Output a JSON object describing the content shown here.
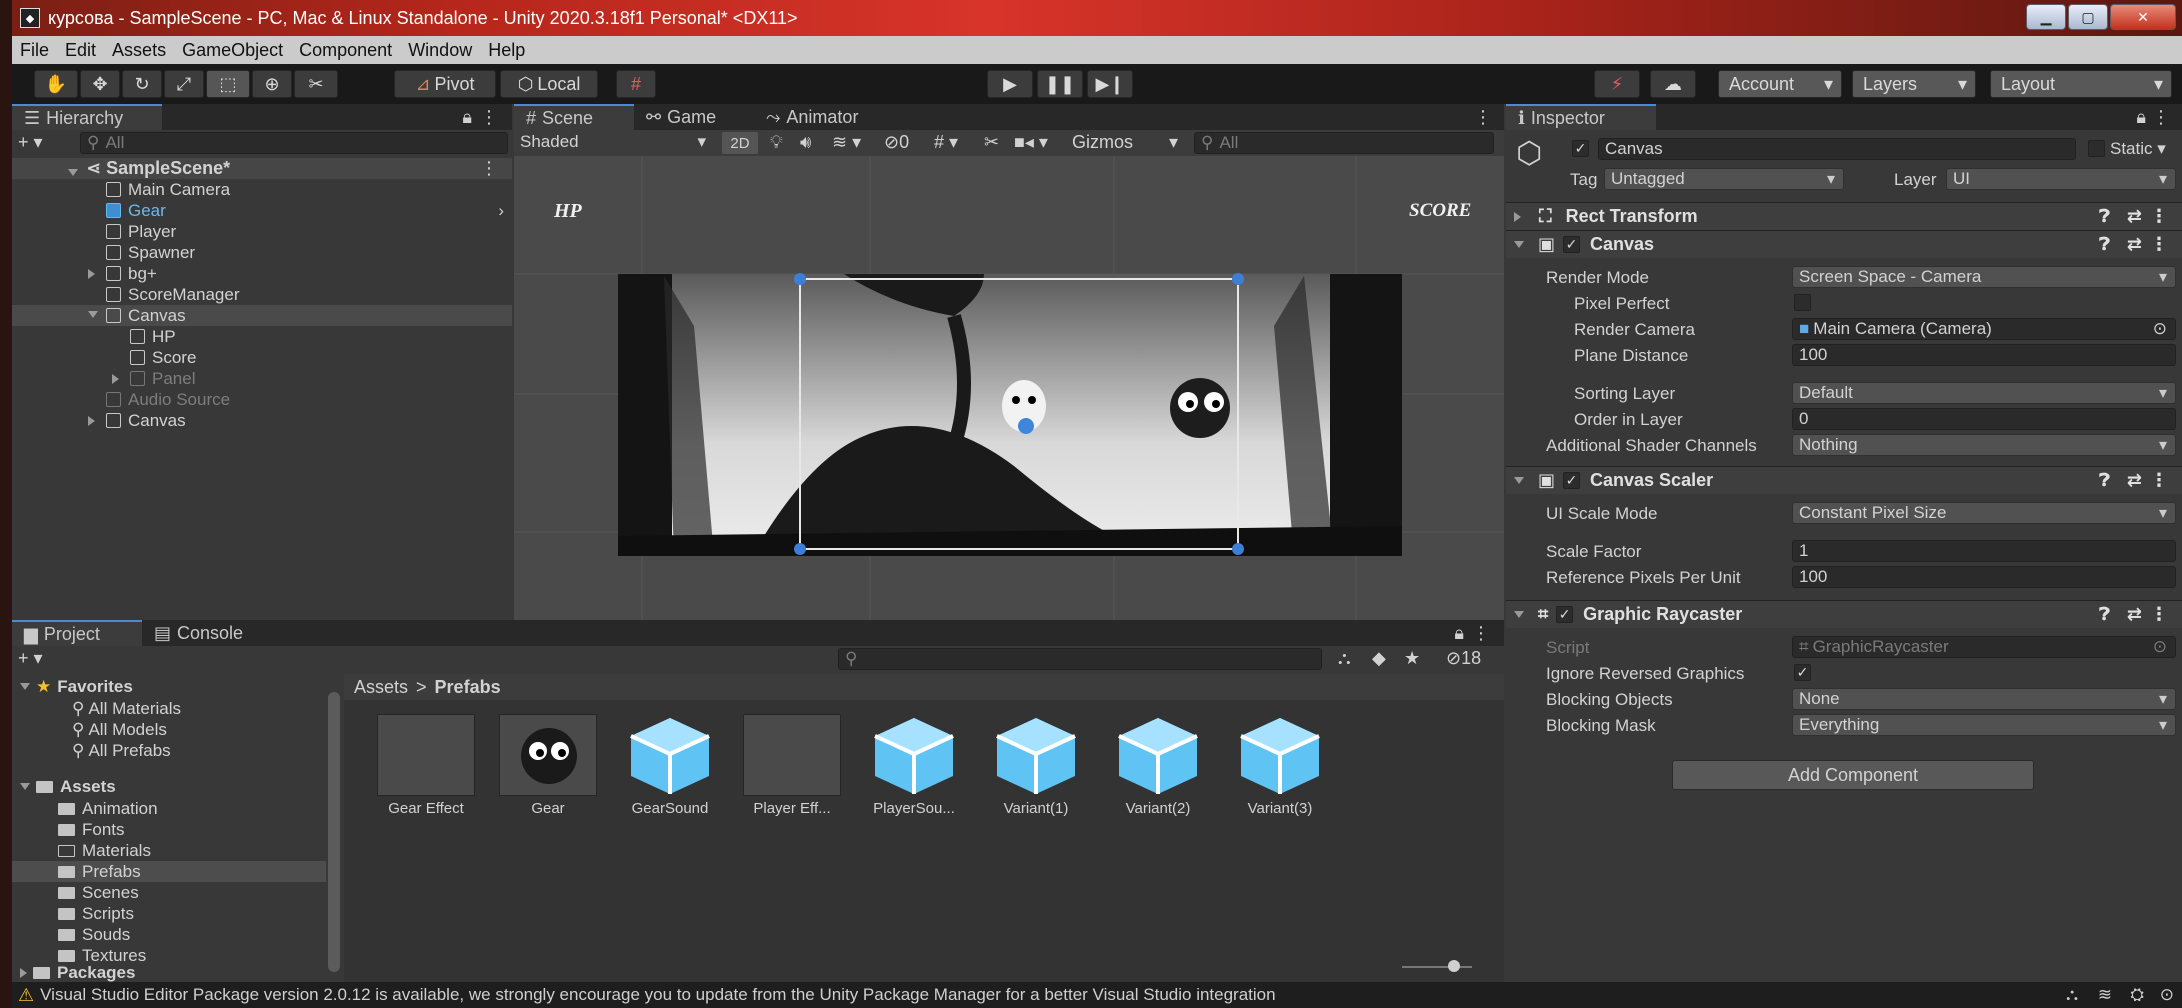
{
  "window": {
    "title": "курсова - SampleScene - PC, Mac & Linux Standalone - Unity 2020.3.18f1 Personal* <DX11>",
    "logo": "unity-logo"
  },
  "menu": [
    "File",
    "Edit",
    "Assets",
    "GameObject",
    "Component",
    "Window",
    "Help"
  ],
  "toolbar": {
    "pivot": "Pivot",
    "local": "Local",
    "account": "Account",
    "layers": "Layers",
    "layout": "Layout"
  },
  "hierarchy": {
    "tab": "Hierarchy",
    "search_placeholder": "All",
    "scene": "SampleScene*",
    "items": [
      {
        "label": "Main Camera",
        "indent": 1
      },
      {
        "label": "Gear",
        "indent": 1
      },
      {
        "label": "Player",
        "indent": 1
      },
      {
        "label": "Spawner",
        "indent": 1
      },
      {
        "label": "bg+",
        "indent": 1
      },
      {
        "label": "ScoreManager",
        "indent": 1
      },
      {
        "label": "Canvas",
        "indent": 1
      },
      {
        "label": "HP",
        "indent": 2
      },
      {
        "label": "Score",
        "indent": 2
      },
      {
        "label": "Panel",
        "indent": 2
      },
      {
        "label": "Audio Source",
        "indent": 1
      },
      {
        "label": "Canvas",
        "indent": 1
      }
    ]
  },
  "scene_view": {
    "tabs": [
      "Scene",
      "Game",
      "Animator"
    ],
    "shading": "Shaded",
    "mode_2d": "2D",
    "hidden_count": "0",
    "gizmos": "Gizmos",
    "search_placeholder": "All",
    "hp_text": "HP",
    "score_text": "SCORE"
  },
  "project": {
    "tabs": [
      "Project",
      "Console"
    ],
    "hidden_count": "18",
    "breadcrumb_root": "Assets",
    "breadcrumb_sep": ">",
    "breadcrumb_current": "Prefabs",
    "favorites_title": "Favorites",
    "favorites": [
      "All Materials",
      "All Models",
      "All Prefabs"
    ],
    "assets_title": "Assets",
    "folders": [
      "Animation",
      "Fonts",
      "Materials",
      "Prefabs",
      "Scenes",
      "Scripts",
      "Souds",
      "Textures"
    ],
    "packages": "Packages",
    "assets": [
      "Gear Effect",
      "Gear",
      "GearSound",
      "Player Eff...",
      "PlayerSou...",
      "Variant(1)",
      "Variant(2)",
      "Variant(3)"
    ]
  },
  "inspector": {
    "tab": "Inspector",
    "object_name": "Canvas",
    "static_label": "Static",
    "tag_label": "Tag",
    "tag_value": "Untagged",
    "layer_label": "Layer",
    "layer_value": "UI",
    "rect_transform": "Rect Transform",
    "canvas": {
      "title": "Canvas",
      "render_mode_label": "Render Mode",
      "render_mode": "Screen Space - Camera",
      "pixel_perfect_label": "Pixel Perfect",
      "render_camera_label": "Render Camera",
      "render_camera": "Main Camera (Camera)",
      "plane_distance_label": "Plane Distance",
      "plane_distance": "100",
      "sorting_layer_label": "Sorting Layer",
      "sorting_layer": "Default",
      "order_label": "Order in Layer",
      "order": "0",
      "shader_channels_label": "Additional Shader Channels",
      "shader_channels": "Nothing"
    },
    "scaler": {
      "title": "Canvas Scaler",
      "scale_mode_label": "UI Scale Mode",
      "scale_mode": "Constant Pixel Size",
      "scale_factor_label": "Scale Factor",
      "scale_factor": "1",
      "ref_pixels_label": "Reference Pixels Per Unit",
      "ref_pixels": "100"
    },
    "raycaster": {
      "title": "Graphic Raycaster",
      "script_label": "Script",
      "script": "GraphicRaycaster",
      "ignore_reversed_label": "Ignore Reversed Graphics",
      "blocking_objects_label": "Blocking Objects",
      "blocking_objects": "None",
      "blocking_mask_label": "Blocking Mask",
      "blocking_mask": "Everything"
    },
    "add_component": "Add Component"
  },
  "status": {
    "message": "Visual Studio Editor Package version 2.0.12 is available, we strongly encourage you to update from the Unity Package Manager for a better Visual Studio integration"
  },
  "colors": {
    "selection": "#2c5d87",
    "accent_blue": "#4a8ad8",
    "warning": "#f2c230"
  }
}
